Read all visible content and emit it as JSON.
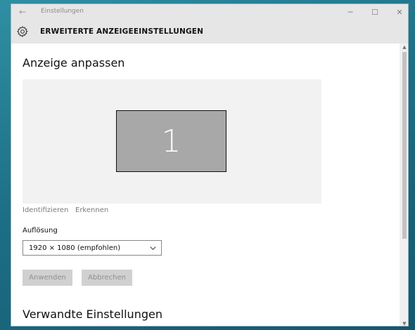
{
  "window": {
    "title": "Einstellungen",
    "back_icon": "back-arrow-icon",
    "controls": {
      "minimize": "─",
      "maximize": "☐",
      "close": "✕"
    }
  },
  "header": {
    "title": "ERWEITERTE ANZEIGEEINSTELLUNGEN",
    "icon": "gear-icon"
  },
  "main": {
    "title": "Anzeige anpassen",
    "display": {
      "number": "1"
    },
    "links": {
      "identify": "Identifizieren",
      "detect": "Erkennen"
    },
    "resolution": {
      "label": "Auflösung",
      "value": "1920 × 1080 (empfohlen)"
    },
    "buttons": {
      "apply": "Anwenden",
      "cancel": "Abbrechen"
    },
    "related_title": "Verwandte Einstellungen"
  },
  "colors": {
    "accent_bg": "#e6e6e6",
    "button_disabled_bg": "#d0d0d0",
    "monitor_fill": "#a8a8a8"
  }
}
